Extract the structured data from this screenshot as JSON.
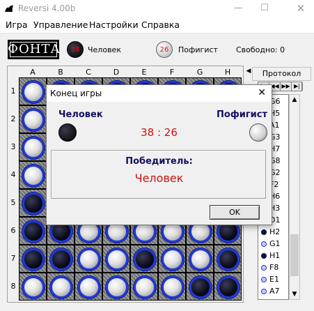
{
  "window": {
    "title": "Reversi 4.00b",
    "min": "—",
    "max": "☐",
    "close": "✕"
  },
  "menu": [
    "Игра",
    "Управление",
    "Настройки",
    "Справка"
  ],
  "toolbar": {
    "logo": "ФОНТА",
    "human": {
      "name": "Человек",
      "score": "38"
    },
    "computer": {
      "name": "Пофигист",
      "score": "26"
    },
    "free_label": "Свободно:  0"
  },
  "board": {
    "columns": [
      "A",
      "B",
      "C",
      "D",
      "E",
      "F",
      "G",
      "H"
    ],
    "rows": [
      "1",
      "2",
      "3",
      "4",
      "5",
      "6",
      "7",
      "8"
    ],
    "cells": [
      [
        "W",
        "B",
        "B",
        "B",
        "B",
        "B",
        "B",
        "B"
      ],
      [
        "W",
        "B",
        "B",
        "B",
        "B",
        "B",
        "B",
        "B"
      ],
      [
        "W",
        "B",
        "B",
        "B",
        "B",
        "B",
        "B",
        "B"
      ],
      [
        "W",
        "B",
        "B",
        "B",
        "B",
        "B",
        "B",
        "B"
      ],
      [
        "B",
        "B",
        "B",
        "B",
        "B",
        "B",
        "B",
        "B"
      ],
      [
        "B",
        "B",
        "W",
        "W",
        "W",
        "W",
        "W",
        "B"
      ],
      [
        "B",
        "B",
        "W",
        "W",
        "B",
        "W",
        "W",
        "B"
      ],
      [
        "W",
        "W",
        "W",
        "W",
        "W",
        "W",
        "B",
        "B"
      ]
    ]
  },
  "protocol": {
    "title": "Протокол",
    "tab_arrow": "◀",
    "nav": [
      "|◀",
      "◀◀",
      "▶▶",
      "▶|"
    ],
    "moves": [
      {
        "color": "",
        "move": "G6"
      },
      {
        "color": "",
        "move": "H5"
      },
      {
        "color": "",
        "move": "A1"
      },
      {
        "color": "",
        "move": "G3"
      },
      {
        "color": "",
        "move": "H7"
      },
      {
        "color": "",
        "move": "G8"
      },
      {
        "color": "",
        "move": "G2"
      },
      {
        "color": "",
        "move": "F2"
      },
      {
        "color": "",
        "move": "H6"
      },
      {
        "color": "",
        "move": "H3"
      },
      {
        "color": "",
        "move": "D1"
      },
      {
        "color": "b",
        "move": "H2"
      },
      {
        "color": "w",
        "move": "G1"
      },
      {
        "color": "b",
        "move": "H1"
      },
      {
        "color": "w",
        "move": "F8"
      },
      {
        "color": "w",
        "move": "E1"
      },
      {
        "color": "s",
        "move": "A7"
      }
    ],
    "scroll_up": "▲",
    "scroll_down": "▼"
  },
  "dialog": {
    "title": "Конец игры",
    "close": "✕",
    "human": "Человек",
    "computer": "Пофигист",
    "score": "38 : 26",
    "winner_label": "Победитель:",
    "winner": "Человек",
    "ok": "OK"
  }
}
